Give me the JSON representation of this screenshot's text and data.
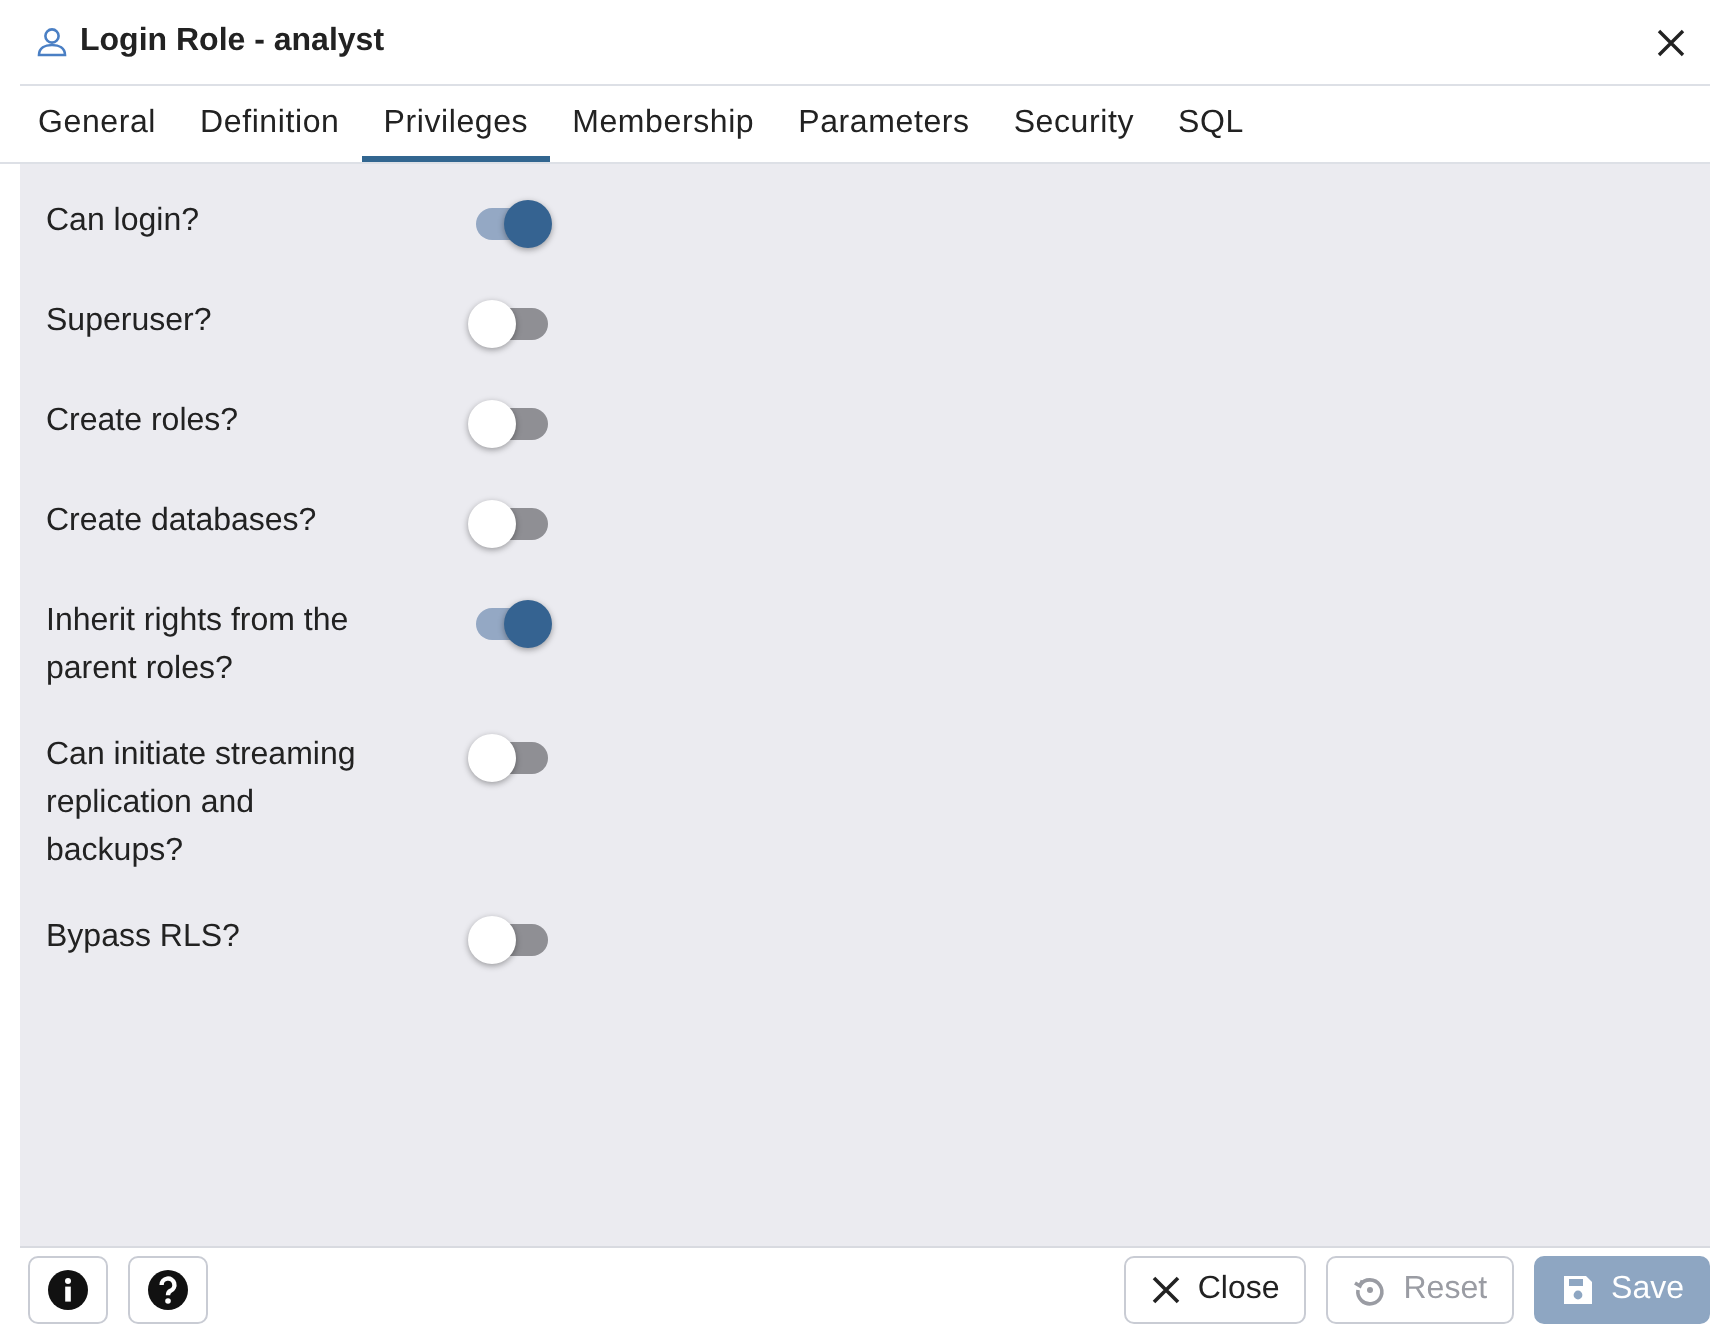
{
  "window": {
    "title": "Login Role - analyst"
  },
  "tabs": [
    {
      "label": "General",
      "selected": false
    },
    {
      "label": "Definition",
      "selected": false
    },
    {
      "label": "Privileges",
      "selected": true
    },
    {
      "label": "Membership",
      "selected": false
    },
    {
      "label": "Parameters",
      "selected": false
    },
    {
      "label": "Security",
      "selected": false
    },
    {
      "label": "SQL",
      "selected": false
    }
  ],
  "privileges": [
    {
      "label": "Can login?",
      "on": true
    },
    {
      "label": "Superuser?",
      "on": false
    },
    {
      "label": "Create roles?",
      "on": false
    },
    {
      "label": "Create databases?",
      "on": false
    },
    {
      "label": "Inherit rights from the parent roles?",
      "on": true
    },
    {
      "label": "Can initiate streaming replication and backups?",
      "on": false
    },
    {
      "label": "Bypass RLS?",
      "on": false
    }
  ],
  "footer": {
    "buttons": [
      {
        "kind": "close",
        "label": "Close",
        "disabled": false
      },
      {
        "kind": "reset",
        "label": "Reset",
        "disabled": true
      },
      {
        "kind": "save",
        "label": "Save",
        "disabled": true
      }
    ]
  }
}
